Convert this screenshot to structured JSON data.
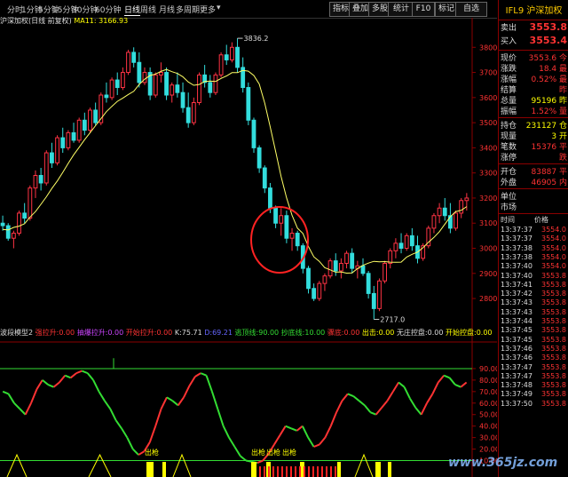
{
  "toolbar": {
    "periods": [
      "分时",
      "1分钟",
      "5分钟",
      "15分钟",
      "30分钟",
      "60分钟",
      "日线",
      "周线",
      "月线",
      "多周期",
      "更多"
    ],
    "active_period": "日线",
    "buttons": [
      "指标",
      "叠加",
      "多股",
      "统计",
      "F10",
      "标记",
      "自选"
    ],
    "more_arrow": "▾"
  },
  "chart_header": {
    "name": "沪深加权(日线 前复权)",
    "ma_label": "MA11: 3166.93"
  },
  "chart_data": [
    {
      "type": "candlestick",
      "title": "沪深加权(日线 前复权)",
      "ylim": [
        2680,
        3900
      ],
      "y_ticks": [
        2800,
        2900,
        3000,
        3100,
        3200,
        3300,
        3400,
        3500,
        3600,
        3700,
        3800
      ],
      "annotations": [
        "3836.2",
        "2717.0"
      ],
      "ma_series": {
        "name": "MA11",
        "values": [
          3075,
          3073,
          3083,
          3088,
          3098,
          3124,
          3146,
          3175,
          3205,
          3238,
          3268,
          3302,
          3338,
          3372,
          3402,
          3432,
          3460,
          3488,
          3516,
          3544,
          3565,
          3585,
          3598,
          3612,
          3625,
          3652,
          3673,
          3688,
          3694,
          3704,
          3712,
          3703,
          3696,
          3683,
          3662,
          3649,
          3652,
          3664,
          3666,
          3664,
          3676,
          3686,
          3699,
          3699,
          3708,
          3705,
          3688,
          3654,
          3578,
          3484,
          3385,
          3286,
          3201,
          3132,
          3080,
          3059,
          3007,
          2966,
          2948,
          2923,
          2914,
          2905,
          2906,
          2901,
          2902,
          2919,
          2932,
          2941,
          2948,
          2946,
          2947,
          2945,
          2944,
          2945,
          2965,
          2976,
          2985,
          3002,
          3024,
          3043,
          3066,
          3096,
          3126,
          3146,
          3151,
          3166
        ]
      },
      "candles": [
        [
          3100,
          3130,
          3070,
          3090
        ],
        [
          3090,
          3100,
          3030,
          3040
        ],
        [
          3040,
          3070,
          3000,
          3060
        ],
        [
          3060,
          3150,
          3050,
          3140
        ],
        [
          3140,
          3180,
          3100,
          3120
        ],
        [
          3120,
          3250,
          3110,
          3240
        ],
        [
          3240,
          3310,
          3200,
          3290
        ],
        [
          3290,
          3320,
          3230,
          3260
        ],
        [
          3260,
          3390,
          3250,
          3380
        ],
        [
          3380,
          3420,
          3320,
          3340
        ],
        [
          3340,
          3450,
          3330,
          3440
        ],
        [
          3440,
          3480,
          3380,
          3400
        ],
        [
          3400,
          3470,
          3390,
          3460
        ],
        [
          3460,
          3500,
          3420,
          3430
        ],
        [
          3430,
          3520,
          3420,
          3510
        ],
        [
          3510,
          3540,
          3450,
          3470
        ],
        [
          3470,
          3560,
          3460,
          3550
        ],
        [
          3550,
          3580,
          3490,
          3500
        ],
        [
          3500,
          3620,
          3490,
          3610
        ],
        [
          3610,
          3660,
          3580,
          3600
        ],
        [
          3600,
          3680,
          3590,
          3670
        ],
        [
          3670,
          3700,
          3610,
          3640
        ],
        [
          3640,
          3720,
          3630,
          3700
        ],
        [
          3700,
          3790,
          3690,
          3780
        ],
        [
          3780,
          3800,
          3720,
          3740
        ],
        [
          3740,
          3780,
          3640,
          3660
        ],
        [
          3660,
          3720,
          3650,
          3700
        ],
        [
          3700,
          3720,
          3590,
          3610
        ],
        [
          3610,
          3700,
          3600,
          3690
        ],
        [
          3690,
          3740,
          3660,
          3700
        ],
        [
          3700,
          3720,
          3590,
          3610
        ],
        [
          3610,
          3660,
          3580,
          3650
        ],
        [
          3650,
          3700,
          3600,
          3620
        ],
        [
          3620,
          3660,
          3540,
          3560
        ],
        [
          3560,
          3620,
          3480,
          3500
        ],
        [
          3500,
          3600,
          3490,
          3580
        ],
        [
          3580,
          3700,
          3570,
          3690
        ],
        [
          3690,
          3730,
          3640,
          3660
        ],
        [
          3660,
          3690,
          3600,
          3620
        ],
        [
          3620,
          3700,
          3610,
          3690
        ],
        [
          3690,
          3780,
          3680,
          3770
        ],
        [
          3770,
          3810,
          3730,
          3750
        ],
        [
          3750,
          3820,
          3740,
          3800
        ],
        [
          3800,
          3836,
          3700,
          3720
        ],
        [
          3720,
          3760,
          3620,
          3640
        ],
        [
          3640,
          3660,
          3490,
          3510
        ],
        [
          3510,
          3520,
          3380,
          3400
        ],
        [
          3400,
          3410,
          3300,
          3320
        ],
        [
          3320,
          3330,
          3220,
          3240
        ],
        [
          3240,
          3260,
          3140,
          3160
        ],
        [
          3160,
          3170,
          3080,
          3100
        ],
        [
          3100,
          3160,
          3050,
          3130
        ],
        [
          3130,
          3150,
          3020,
          3040
        ],
        [
          3040,
          3080,
          2990,
          3060
        ],
        [
          3060,
          3070,
          2990,
          3010
        ],
        [
          3010,
          3020,
          2900,
          2920
        ],
        [
          2920,
          2930,
          2820,
          2840
        ],
        [
          2840,
          2860,
          2790,
          2800
        ],
        [
          2800,
          2870,
          2790,
          2860
        ],
        [
          2860,
          2900,
          2830,
          2890
        ],
        [
          2890,
          2960,
          2880,
          2950
        ],
        [
          2950,
          2980,
          2890,
          2910
        ],
        [
          2910,
          2960,
          2880,
          2940
        ],
        [
          2940,
          2990,
          2920,
          2980
        ],
        [
          2980,
          3000,
          2900,
          2920
        ],
        [
          2920,
          2950,
          2880,
          2930
        ],
        [
          2930,
          2960,
          2890,
          2900
        ],
        [
          2900,
          2910,
          2800,
          2820
        ],
        [
          2820,
          2850,
          2717,
          2760
        ],
        [
          2760,
          2880,
          2750,
          2870
        ],
        [
          2870,
          2950,
          2860,
          2940
        ],
        [
          2940,
          3000,
          2920,
          2990
        ],
        [
          2990,
          3040,
          2960,
          3020
        ],
        [
          3020,
          3060,
          2980,
          3000
        ],
        [
          3000,
          3060,
          2990,
          3050
        ],
        [
          3050,
          3080,
          2990,
          3010
        ],
        [
          3010,
          3050,
          2940,
          2960
        ],
        [
          2960,
          3020,
          2950,
          3010
        ],
        [
          3010,
          3090,
          3000,
          3080
        ],
        [
          3080,
          3140,
          3060,
          3130
        ],
        [
          3130,
          3180,
          3100,
          3160
        ],
        [
          3160,
          3200,
          3110,
          3130
        ],
        [
          3130,
          3180,
          3060,
          3080
        ],
        [
          3080,
          3150,
          3070,
          3140
        ],
        [
          3140,
          3200,
          3120,
          3190
        ],
        [
          3190,
          3220,
          3150,
          3200
        ]
      ]
    },
    {
      "type": "line",
      "title": "波段模型2",
      "ylim": [
        5,
        100
      ],
      "y_ticks": [
        10,
        20,
        30,
        40,
        50,
        60,
        70,
        80,
        90
      ],
      "series": [
        {
          "name": "强拉升",
          "values": [
            70,
            68,
            60,
            55,
            50,
            60,
            72,
            80,
            76,
            74,
            78,
            84,
            82,
            86,
            88,
            86,
            80,
            70,
            62,
            55,
            45,
            38,
            30,
            20,
            15,
            18,
            26,
            40,
            55,
            65,
            62,
            58,
            65,
            75,
            83,
            86,
            84,
            70,
            55,
            40,
            30,
            22,
            14,
            10,
            9,
            8,
            10,
            16,
            24,
            32,
            40,
            38,
            36,
            40,
            30,
            22,
            24,
            30,
            40,
            52,
            62,
            68,
            66,
            62,
            58,
            52,
            50,
            56,
            62,
            70,
            78,
            74,
            64,
            56,
            50,
            60,
            68,
            78,
            84,
            82,
            76,
            74,
            78
          ]
        }
      ],
      "legend": [
        {
          "label": "波段模型2",
          "value": "",
          "color": "#dddddd"
        },
        {
          "label": "强拉升:",
          "value": "0.00",
          "color": "#ff3333"
        },
        {
          "label": "抽爆拉升:",
          "value": "0.00",
          "color": "#cc44ff"
        },
        {
          "label": "开始拉升:",
          "value": "0.00",
          "color": "#ff3333"
        },
        {
          "label": "K:",
          "value": "75.71",
          "color": "#dddddd"
        },
        {
          "label": "D:",
          "value": "69.21",
          "color": "#6666ff"
        },
        {
          "label": "逃顶线:",
          "value": "90.00",
          "color": "#33dd33"
        },
        {
          "label": "抄底线:",
          "value": "10.00",
          "color": "#33dd33"
        },
        {
          "label": "骤底:",
          "value": "0.00",
          "color": "#ff3333"
        },
        {
          "label": "出击:",
          "value": "0.00",
          "color": "#ffff00"
        },
        {
          "label": "无庄控盘:",
          "value": "0.00",
          "color": "#dddddd"
        },
        {
          "label": "开始控盘:",
          "value": "0.00",
          "color": "#ffff00"
        }
      ],
      "annotations": [
        "出枪",
        "出枪",
        "出枪",
        "出枪"
      ]
    }
  ],
  "quote_panel": {
    "title": "IFL9 沪深加权",
    "sell": {
      "label": "卖出",
      "value": "3553.8"
    },
    "buy": {
      "label": "买入",
      "value": "3553.4"
    },
    "rows1": [
      {
        "k": "现价",
        "v": "3553.6",
        "c": "red",
        "unit": "今"
      },
      {
        "k": "涨跌",
        "v": "18.4",
        "c": "red",
        "unit": "最"
      },
      {
        "k": "涨幅",
        "v": "0.52%",
        "c": "red",
        "unit": "最"
      },
      {
        "k": "结算",
        "v": "",
        "c": "red",
        "unit": "昨"
      },
      {
        "k": "总量",
        "v": "95196",
        "c": "yel",
        "unit": "昨"
      },
      {
        "k": "振幅",
        "v": "1.52%",
        "c": "red",
        "unit": "量"
      }
    ],
    "rows2": [
      {
        "k": "持仓",
        "v": "231127",
        "c": "yel",
        "unit": "仓"
      },
      {
        "k": "现量",
        "v": "3",
        "c": "yel",
        "unit": "开"
      },
      {
        "k": "笔数",
        "v": "15376",
        "c": "red",
        "unit": "平"
      },
      {
        "k": "涨停",
        "v": "",
        "c": "red",
        "unit": "跌"
      }
    ],
    "rows3": [
      {
        "k": "开仓",
        "v": "83887",
        "c": "red",
        "unit": "平"
      },
      {
        "k": "外盘",
        "v": "46905",
        "c": "red",
        "unit": "内"
      }
    ],
    "rows4": [
      {
        "k": "单位",
        "v": "",
        "c": "red",
        "unit": ""
      },
      {
        "k": "市场",
        "v": "",
        "c": "red",
        "unit": ""
      }
    ],
    "trades_header": {
      "time": "时间",
      "price": "价格"
    },
    "trades": [
      {
        "t": "13:37:37",
        "p": "3554.0"
      },
      {
        "t": "13:37:37",
        "p": "3554.0"
      },
      {
        "t": "13:37:38",
        "p": "3554.0"
      },
      {
        "t": "13:37:38",
        "p": "3554.0"
      },
      {
        "t": "13:37:40",
        "p": "3554.0"
      },
      {
        "t": "13:37:40",
        "p": "3553.8"
      },
      {
        "t": "13:37:41",
        "p": "3553.8"
      },
      {
        "t": "13:37:42",
        "p": "3553.8"
      },
      {
        "t": "13:37:43",
        "p": "3553.8"
      },
      {
        "t": "13:37:43",
        "p": "3553.8"
      },
      {
        "t": "13:37:44",
        "p": "3553.8"
      },
      {
        "t": "13:37:45",
        "p": "3553.8"
      },
      {
        "t": "13:37:45",
        "p": "3553.8"
      },
      {
        "t": "13:37:46",
        "p": "3553.8"
      },
      {
        "t": "13:37:46",
        "p": "3553.8"
      },
      {
        "t": "13:37:47",
        "p": "3553.8"
      },
      {
        "t": "13:37:47",
        "p": "3553.8"
      },
      {
        "t": "13:37:48",
        "p": "3553.8"
      },
      {
        "t": "13:37:49",
        "p": "3553.8"
      },
      {
        "t": "13:37:50",
        "p": "3553.8"
      }
    ]
  },
  "watermark": "www.365jz.com",
  "colors": {
    "up": "#ff3344",
    "down": "#33dddd",
    "ma": "#ffff66",
    "grid": "#8b0000",
    "k_up": "#ff3333",
    "k_down": "#33dd33"
  }
}
